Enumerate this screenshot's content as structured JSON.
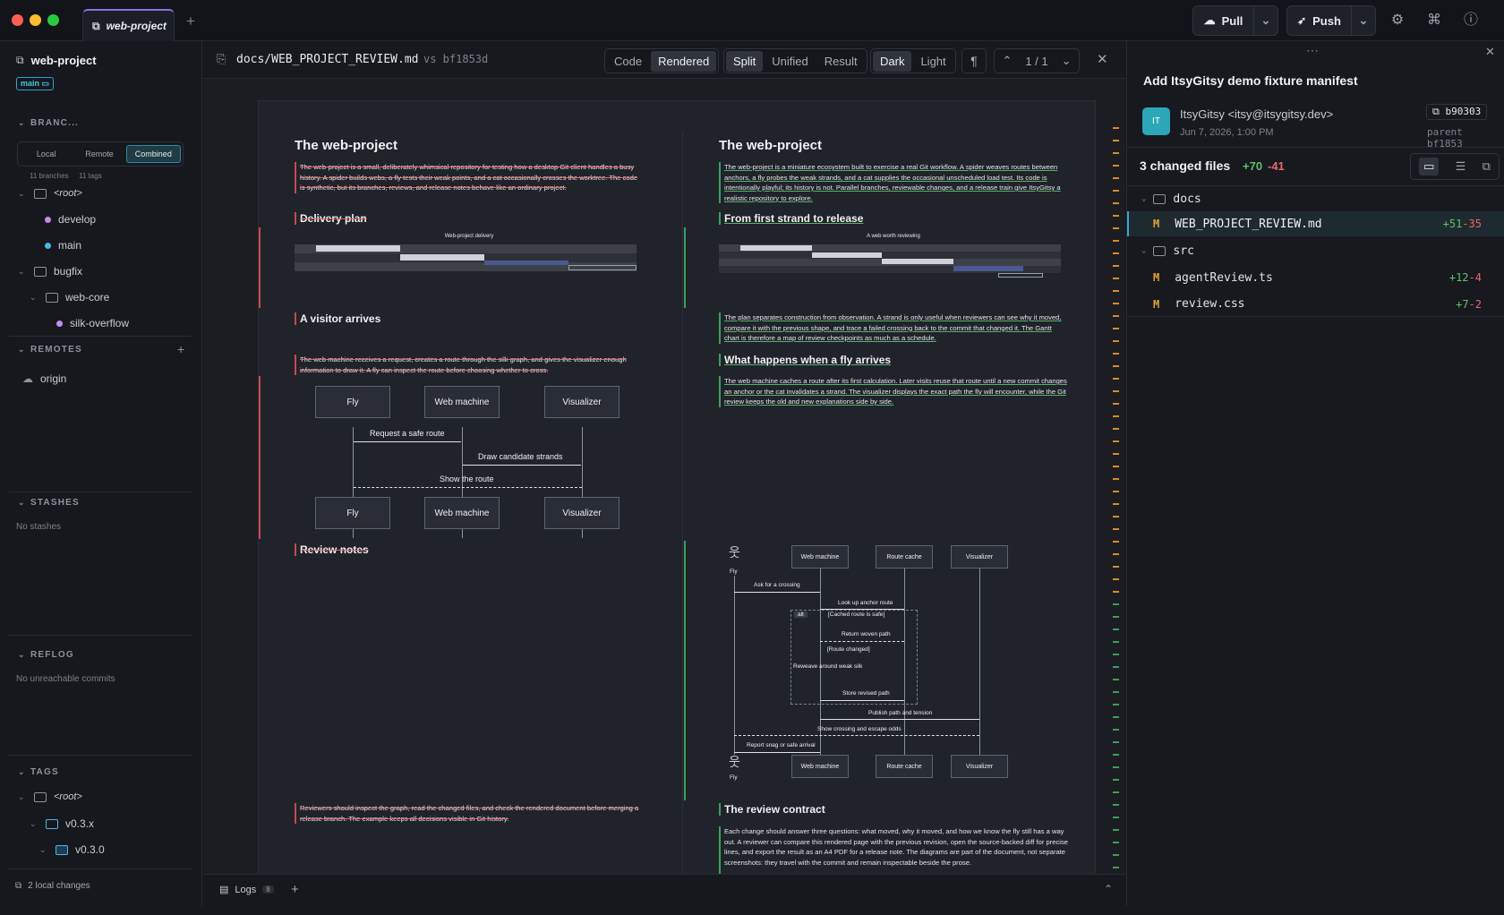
{
  "window": {
    "tab_title": "web-project"
  },
  "toolbar": {
    "pull_label": "Pull",
    "push_label": "Push"
  },
  "sidebar": {
    "repo_name": "web-project",
    "branch_badge": "main",
    "branches_header": "BRANC...",
    "filter_tabs": [
      "Local",
      "Remote",
      "Combined"
    ],
    "branch_count": "11 branches",
    "tag_count": "11 tags",
    "tree": {
      "root": "<root>",
      "develop": "develop",
      "main": "main",
      "bugfix": "bugfix",
      "web_core": "web-core",
      "silk": "silk-overflow"
    },
    "remotes_header": "REMOTES",
    "origin": "origin",
    "stashes_header": "STASHES",
    "stashes_empty": "No stashes",
    "reflog_header": "REFLOG",
    "reflog_empty": "No unreachable commits",
    "tags_header": "TAGS",
    "tags_tree": {
      "root": "<root>",
      "v03x": "v0.3.x",
      "v030": "v0.3.0"
    },
    "local_changes": "2 local changes"
  },
  "diff": {
    "file_path": "docs/WEB_PROJECT_REVIEW.md",
    "vs_label": "vs bf1853d",
    "view_modes": [
      "Code",
      "Rendered"
    ],
    "layout_modes": [
      "Split",
      "Unified",
      "Result"
    ],
    "themes": [
      "Dark",
      "Light"
    ],
    "pager": "1 / 1"
  },
  "left_doc": {
    "title": "The web-project",
    "intro": "The web-project is a small, deliberately whimsical repository for testing how a desktop Git client handles a busy history. A spider builds webs, a fly tests their weak points, and a cat occasionally crosses the worktree. The code is synthetic, but its branches, reviews, and release notes behave like an ordinary project.",
    "h_delivery": "Delivery plan",
    "gantt_title": "Web-project delivery",
    "h_visitor": "A visitor arrives",
    "visitor_para": "The web machine receives a request, creates a route through the silk graph, and gives the visualizer enough information to draw it. A fly can inspect the route before choosing whether to cross.",
    "seq": {
      "fly": "Fly",
      "web": "Web machine",
      "vis": "Visualizer",
      "m1": "Request a safe route",
      "m2": "Draw candidate strands",
      "m3": "Show the route"
    },
    "h_review": "Review notes",
    "review_para": "Reviewers should inspect the graph, read the changed files, and check the rendered document before merging a release branch. The example keeps all decisions visible in Git history."
  },
  "right_doc": {
    "title": "The web-project",
    "intro": "The web-project is a miniature ecosystem built to exercise a real Git workflow. A spider weaves routes between anchors, a fly probes the weak strands, and a cat supplies the occasional unscheduled load test. Its code is intentionally playful; its history is not. Parallel branches, reviewable changes, and a release train give ItsyGitsy a realistic repository to explore.",
    "h_release": "From first strand to release",
    "gantt_title": "A web worth reviewing",
    "plan_para": "The plan separates construction from observation. A strand is only useful when reviewers can see why it moved, compare it with the previous shape, and trace a failed crossing back to the commit that changed it. The Gantt chart is therefore a map of review checkpoints as much as a schedule.",
    "h_fly": "What happens when a fly arrives",
    "fly_para": "The web machine caches a route after its first calculation. Later visits reuse that route until a new commit changes an anchor or the cat invalidates a strand. The visualizer displays the exact path the fly will encounter, while the Git review keeps the old and new explanations side by side.",
    "seq": {
      "fly": "Fly",
      "web": "Web machine",
      "cache": "Route cache",
      "vis": "Visualizer",
      "m1": "Ask for a crossing",
      "m2": "Look up anchor route",
      "alt": "alt",
      "cond1": "[Cached route is safe]",
      "m3": "Return woven path",
      "cond2": "[Route changed]",
      "m4": "Reweave around weak silk",
      "m5": "Store revised path",
      "m6": "Publish path and tension",
      "m7": "Show crossing and escape odds",
      "m8": "Report snag or safe arrival"
    },
    "h_contract": "The review contract",
    "contract_para": "Each change should answer three questions: what moved, why it moved, and how we know the fly still has a way out. A reviewer can compare this rendered page with the previous revision, open the source-backed diff for precise lines, and export the result as an A4 PDF for a release note. The diagrams are part of the document, not separate screenshots: they travel with the commit and remain inspectable beside the prose."
  },
  "commit": {
    "title": "Add ItsyGitsy demo fixture manifest",
    "avatar": "IT",
    "author": "ItsyGitsy <itsy@itsygitsy.dev>",
    "date": "Jun 7, 2026, 1:00 PM",
    "sha": "b90303",
    "parent": "parent bf1853",
    "changed": "3 changed files",
    "added": "+70",
    "removed": "-41",
    "files": [
      {
        "folder": "docs"
      },
      {
        "status": "M",
        "name": "WEB_PROJECT_REVIEW.md",
        "add": "+51",
        "del": "-35"
      },
      {
        "folder": "src"
      },
      {
        "status": "M",
        "name": "agentReview.ts",
        "add": "+12",
        "del": "-4"
      },
      {
        "status": "M",
        "name": "review.css",
        "add": "+7",
        "del": "-2"
      }
    ]
  },
  "bottom": {
    "logs": "Logs",
    "logs_count": "8"
  },
  "colors": {
    "accent": "#8a6ee6",
    "added": "#5ec26a",
    "removed": "#e8686b",
    "modified": "#e3a33b"
  }
}
